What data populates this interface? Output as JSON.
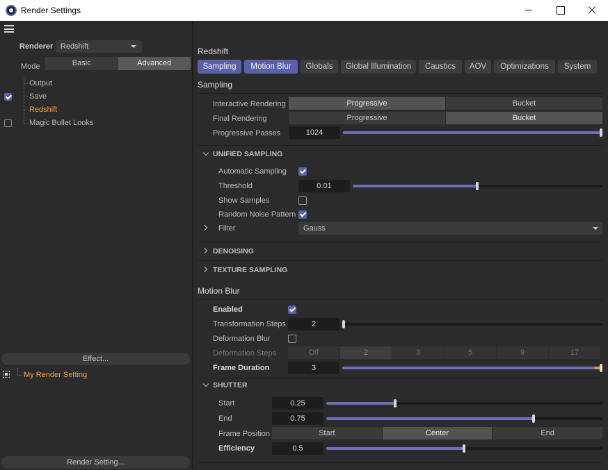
{
  "window": {
    "title": "Render Settings"
  },
  "left": {
    "renderer_label": "Renderer",
    "renderer_value": "Redshift",
    "mode_label": "Mode",
    "mode_options": [
      "Basic",
      "Advanced"
    ],
    "mode_selected": "Advanced",
    "tree": [
      {
        "label": "Output",
        "checked": null,
        "selected": false
      },
      {
        "label": "Save",
        "checked": true,
        "selected": false
      },
      {
        "label": "Redshift",
        "checked": null,
        "selected": true
      },
      {
        "label": "Magic Bullet Looks",
        "checked": false,
        "selected": false
      }
    ],
    "effect_button": "Effect...",
    "render_settings_list": [
      "My Render Setting"
    ],
    "render_setting_button": "Render Setting..."
  },
  "right": {
    "title": "Redshift",
    "tabs": [
      "Sampling",
      "Motion Blur",
      "Globals",
      "Global Illumination",
      "Caustics",
      "AOV",
      "Optimizations",
      "System"
    ],
    "active_tabs": [
      "Sampling",
      "Motion Blur"
    ],
    "sampling": {
      "header": "Sampling",
      "interactive_rendering": {
        "label": "Interactive Rendering",
        "options": [
          "Progressive",
          "Bucket"
        ],
        "selected": "Progressive"
      },
      "final_rendering": {
        "label": "Final Rendering",
        "options": [
          "Progressive",
          "Bucket"
        ],
        "selected": "Bucket"
      },
      "progressive_passes": {
        "label": "Progressive Passes",
        "value": "1024",
        "fraction": 1.0
      },
      "unified": {
        "header": "UNIFIED SAMPLING",
        "automatic_sampling": {
          "label": "Automatic Sampling",
          "checked": true
        },
        "threshold": {
          "label": "Threshold",
          "value": "0.01",
          "fraction": 0.5
        },
        "show_samples": {
          "label": "Show Samples",
          "checked": false
        },
        "random_noise": {
          "label": "Random Noise Pattern",
          "checked": true
        },
        "filter": {
          "label": "Filter",
          "value": "Gauss"
        }
      },
      "denoising": "DENOISING",
      "texture_sampling": "TEXTURE SAMPLING"
    },
    "motion_blur": {
      "header": "Motion Blur",
      "enabled": {
        "label": "Enabled",
        "checked": true
      },
      "transformation_steps": {
        "label": "Transformation Steps",
        "value": "2",
        "fraction": 0.0
      },
      "deformation_blur": {
        "label": "Deformation Blur",
        "checked": false
      },
      "deformation_steps": {
        "label": "Deformation Steps",
        "options": [
          "Off",
          "2",
          "3",
          "5",
          "9",
          "17"
        ],
        "selected": "2"
      },
      "frame_duration": {
        "label": "Frame Duration",
        "value": "3",
        "fraction": 1.0
      },
      "shutter": {
        "header": "SHUTTER",
        "start": {
          "label": "Start",
          "value": "0.25",
          "fraction": 0.25
        },
        "end": {
          "label": "End",
          "value": "0.75",
          "fraction": 0.75
        },
        "frame_position": {
          "label": "Frame Position",
          "options": [
            "Start",
            "Center",
            "End"
          ],
          "selected": "Center"
        },
        "efficiency": {
          "label": "Efficiency",
          "value": "0.5",
          "fraction": 0.5
        }
      }
    }
  },
  "colors": {
    "accent": "#5960a8",
    "highlight": "#f0a24a",
    "background": "#2b2b2b"
  }
}
